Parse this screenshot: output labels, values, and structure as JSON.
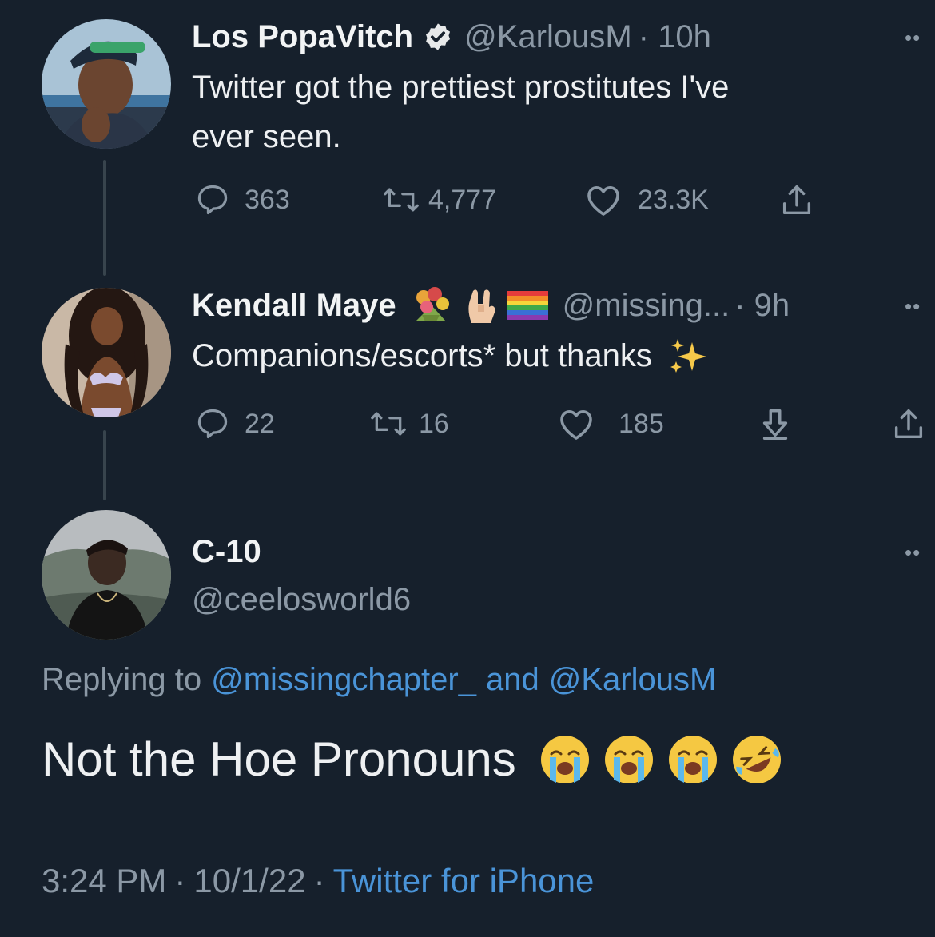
{
  "tweet1": {
    "display_name": "Los PopaVitch",
    "verified_icon": "verified-badge-icon",
    "handle": "@KarlousM",
    "time": "· 10h",
    "text_line1": "Twitter got the prettiest prostitutes I've",
    "text_line2": "ever seen.",
    "replies": "363",
    "retweets": "4,777",
    "likes": "23.3K"
  },
  "tweet2": {
    "display_name": "Kendall Maye",
    "name_emojis": [
      "bouquet-emoji",
      "sign-of-horns-emoji",
      "rainbow-flag-emoji"
    ],
    "handle": "@missing...",
    "time": "· 9h",
    "text": "Companions/escorts* but thanks",
    "text_emoji": "sparkles-emoji",
    "replies": "22",
    "retweets": "16",
    "likes": "185"
  },
  "tweet3": {
    "display_name": "C-10",
    "handle": "@ceelosworld6",
    "replying_prefix": "Replying to",
    "reply_mention1": "@missingchapter_",
    "reply_and": "and",
    "reply_mention2": "@KarlousM",
    "text": "Not the Hoe Pronouns",
    "text_emojis": [
      "loudly-crying-face-emoji",
      "loudly-crying-face-emoji",
      "loudly-crying-face-emoji",
      "rolling-on-floor-laughing-emoji"
    ],
    "time": "3:24 PM",
    "date": "10/1/22",
    "source": "Twitter for iPhone"
  },
  "colors": {
    "background": "#16202c",
    "text": "#e7e9ea",
    "muted": "#8b98a5",
    "link": "#4a94d8"
  }
}
